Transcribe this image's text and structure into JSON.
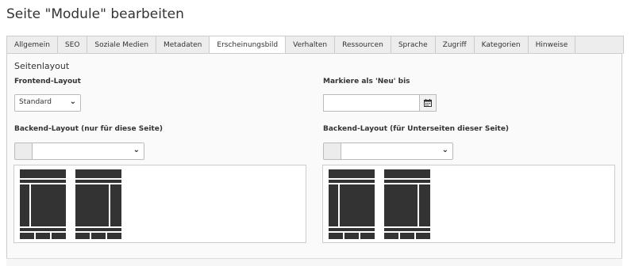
{
  "page": {
    "title": "Seite \"Module\" bearbeiten"
  },
  "tabs": [
    {
      "label": "Allgemein"
    },
    {
      "label": "SEO"
    },
    {
      "label": "Soziale Medien"
    },
    {
      "label": "Metadaten"
    },
    {
      "label": "Erscheinungsbild",
      "active": true
    },
    {
      "label": "Verhalten"
    },
    {
      "label": "Ressourcen"
    },
    {
      "label": "Sprache"
    },
    {
      "label": "Zugriff"
    },
    {
      "label": "Kategorien"
    },
    {
      "label": "Hinweise"
    }
  ],
  "section": {
    "title": "Seitenlayout"
  },
  "frontend_layout": {
    "label": "Frontend-Layout",
    "value": "Standard"
  },
  "new_until": {
    "label": "Markiere als 'Neu' bis",
    "value": ""
  },
  "backend_layout_page": {
    "label": "Backend-Layout (nur für diese Seite)",
    "value": ""
  },
  "backend_layout_sub": {
    "label": "Backend-Layout (für Unterseiten dieser Seite)",
    "value": ""
  },
  "icons": {
    "chevron": "chevron-down-icon",
    "calendar": "calendar-icon",
    "layout_a": "layout-three-column-icon",
    "layout_b": "layout-three-column-right-icon"
  },
  "colors": {
    "layout_block": "#333333",
    "tab_bg": "#ededed",
    "panel_bg": "#fafafa"
  }
}
